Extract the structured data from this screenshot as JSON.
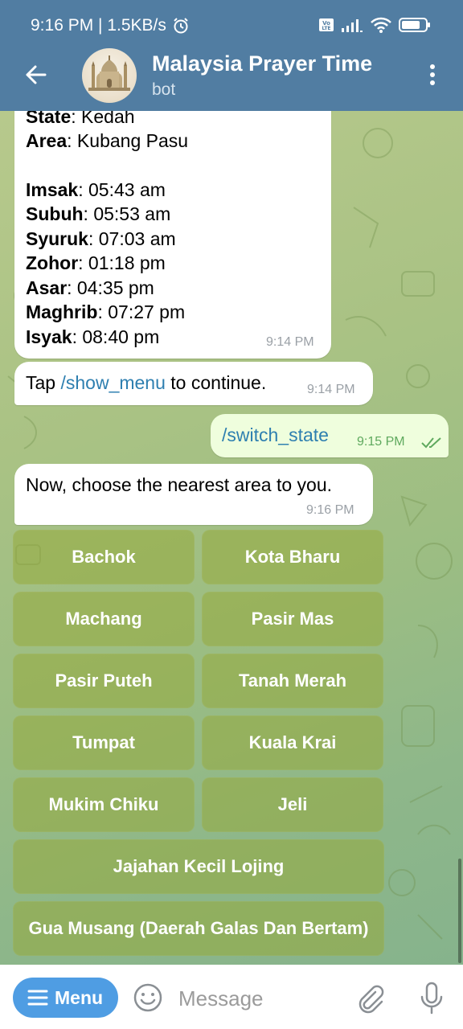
{
  "status_bar": {
    "time": "9:16 PM | 1.5KB/s"
  },
  "header": {
    "title": "Malaysia Prayer Time",
    "subtitle": "bot"
  },
  "messages": {
    "prayer": {
      "state_label": "State",
      "state_value": ": Kedah",
      "area_label": "Area",
      "area_value": ": Kubang Pasu",
      "times": [
        {
          "label": "Imsak",
          "value": ": 05:43 am"
        },
        {
          "label": "Subuh",
          "value": ": 05:53 am"
        },
        {
          "label": "Syuruk",
          "value": ": 07:03 am"
        },
        {
          "label": "Zohor",
          "value": ": 01:18 pm"
        },
        {
          "label": "Asar",
          "value": ": 04:35 pm"
        },
        {
          "label": "Maghrib",
          "value": ": 07:27 pm"
        },
        {
          "label": "Isyak",
          "value": ": 08:40 pm"
        }
      ],
      "time": "9:14 PM"
    },
    "tap_menu": {
      "prefix": "Tap ",
      "command": "/show_menu",
      "suffix": " to continue.",
      "time": "9:14 PM"
    },
    "switch_state": {
      "command": "/switch_state",
      "time": "9:15 PM"
    },
    "choose_area": {
      "text": "Now, choose the nearest area to you.",
      "time": "9:16 PM"
    }
  },
  "keyboard": {
    "buttons": [
      "Bachok",
      "Kota Bharu",
      "Machang",
      "Pasir Mas",
      "Pasir Puteh",
      "Tanah Merah",
      "Tumpat",
      "Kuala Krai",
      "Mukim Chiku",
      "Jeli",
      "Jajahan Kecil Lojing",
      "Gua Musang (Daerah Galas Dan Bertam)"
    ]
  },
  "composer": {
    "menu_label": "Menu",
    "placeholder": "Message"
  },
  "icons": {
    "back": "arrow-left-icon",
    "more": "more-vertical-icon",
    "emoji": "smile-icon",
    "attach": "paperclip-icon",
    "mic": "microphone-icon",
    "sent": "double-check-icon"
  },
  "colors": {
    "header": "#517da2",
    "link": "#2e7fb0",
    "menu_button": "#4f9de3",
    "outgoing_bubble": "#effedd",
    "keyboard_button": "#96aa3c"
  }
}
